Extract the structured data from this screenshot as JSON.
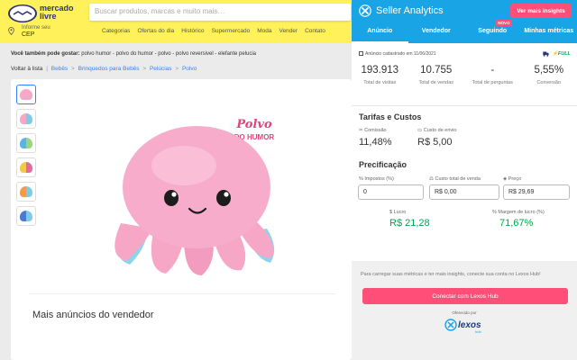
{
  "ml": {
    "logo_line1": "mercado",
    "logo_line2": "livre",
    "search_placeholder": "Buscar produtos, marcas e muito mais…",
    "cep_label": "Informe seu",
    "cep_value": "CEP",
    "nav": [
      "Categorias",
      "Ofertas do dia",
      "Histórico",
      "Supermercado",
      "Moda",
      "Vender",
      "Contato"
    ],
    "suggest_prefix": "Você também pode gostar:",
    "suggest_text": "polvo humor - polvo do humor - polvo - polvo reversivel - elefante pelucia",
    "back": "Voltar à lista",
    "breadcrumbs": [
      "Bebês",
      "Brinquedos para Bebês",
      "Pelúcias",
      "Polvo"
    ],
    "product_text_1": "Polvo",
    "product_text_2": "DO HUMOR",
    "more_title": "Mais anúncios do vendedor"
  },
  "sa": {
    "title": "Seller Analytics",
    "insights_btn": "Ver mais insights",
    "tabs": [
      "Anúncio",
      "Vendedor",
      "Seguindo",
      "Minhas métricas"
    ],
    "new_badge": "NOVO",
    "updated": "Anúncio cadastrado em 11/06/2021",
    "full": "FULL",
    "stats": [
      {
        "value": "193.913",
        "label": "Total de visitas"
      },
      {
        "value": "10.755",
        "label": "Total de vendas"
      },
      {
        "value": "-",
        "label": "Total de perguntas"
      },
      {
        "value": "5,55%",
        "label": "Conversão"
      }
    ],
    "fees_title": "Tarifas e Custos",
    "commission_label": "Comissão",
    "commission_value": "11,48%",
    "shipping_label": "Custo de envio",
    "shipping_value": "R$ 5,00",
    "pricing_title": "Precificação",
    "tax_label": "Impostos (%)",
    "tax_value": "0",
    "cost_label": "Custo total de venda",
    "cost_value": "R$ 0,00",
    "price_label": "Preço",
    "price_value": "R$ 29,69",
    "profit_label": "Lucro",
    "profit_value": "R$ 21,28",
    "margin_label": "Margem de lucro (%)",
    "margin_value": "71,67%",
    "message": "Para carregar suas métricas e ter mais insights, conecte sua conta no Lexos Hub!",
    "connect_btn": "Conectar com Lexos Hub",
    "offered_by": "Oferecido por",
    "lexos_word": "lexos",
    "lexos_sub": "hub"
  },
  "colors": {
    "ml_yellow": "#fff159",
    "sa_blue": "#19a4e5",
    "accent_pink": "#ff4f78",
    "success_green": "#00a650",
    "link_blue": "#3483fa"
  }
}
